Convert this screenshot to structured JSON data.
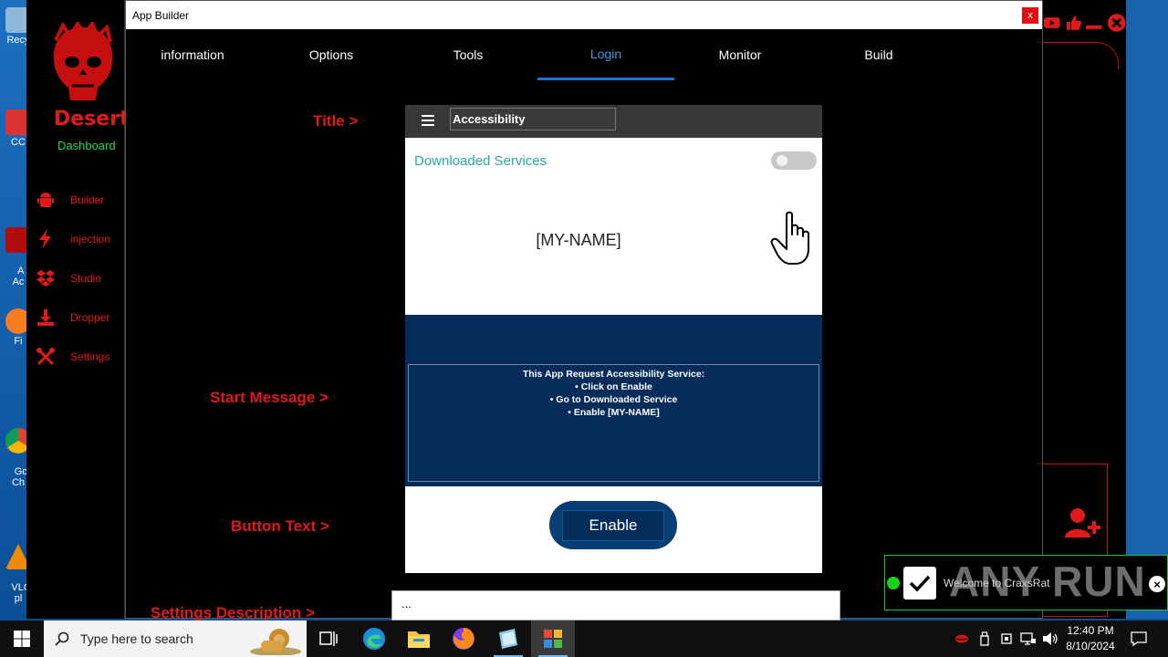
{
  "window": {
    "title": "App Builder",
    "close_label": "x"
  },
  "tabs": [
    {
      "label": "information"
    },
    {
      "label": "Options"
    },
    {
      "label": "Tools"
    },
    {
      "label": "Login"
    },
    {
      "label": "Monitor"
    },
    {
      "label": "Build"
    }
  ],
  "active_tab": "Login",
  "dashboard": {
    "brand": "Desert",
    "subtitle": "Dashboard",
    "items": [
      {
        "label": "Builder",
        "icon": "android-icon"
      },
      {
        "label": "injection",
        "icon": "bolt-icon"
      },
      {
        "label": "Studio",
        "icon": "dropbox-icon"
      },
      {
        "label": "Dropper",
        "icon": "download-icon"
      },
      {
        "label": "Settings",
        "icon": "tools-icon"
      }
    ]
  },
  "form_labels": {
    "title": "Title >",
    "start_message": "Start Message >",
    "button_text": "Button Text >",
    "settings_description": "Settings Description >"
  },
  "preview": {
    "title_value": "Accessibility",
    "downloaded_services": "Downloaded Services",
    "app_name": "[MY-NAME]",
    "start_message_lines": [
      "This App Request Accessibility Service:",
      "• Click on Enable",
      "• Go to Downloaded Service",
      "• Enable [MY-NAME]"
    ],
    "button_text": "Enable",
    "settings_description_value": "..."
  },
  "desktop_icons": [
    {
      "label": "Recy"
    },
    {
      "label": "CC"
    },
    {
      "label": "A\nAc"
    },
    {
      "label": "Fi"
    },
    {
      "label": "Go\nCh"
    },
    {
      "label": "VLC\npl"
    }
  ],
  "notification": {
    "text": "Welcome to CraxsRat",
    "close_label": "×",
    "watermark": "ANY RUN"
  },
  "taskbar": {
    "search_placeholder": "Type here to search",
    "time": "12:40 PM",
    "date": "8/10/2024"
  },
  "colors": {
    "accent_red": "#e01a1a",
    "active_tab": "#3a9dea",
    "navy": "#062c5a",
    "green": "#1edc4a"
  }
}
